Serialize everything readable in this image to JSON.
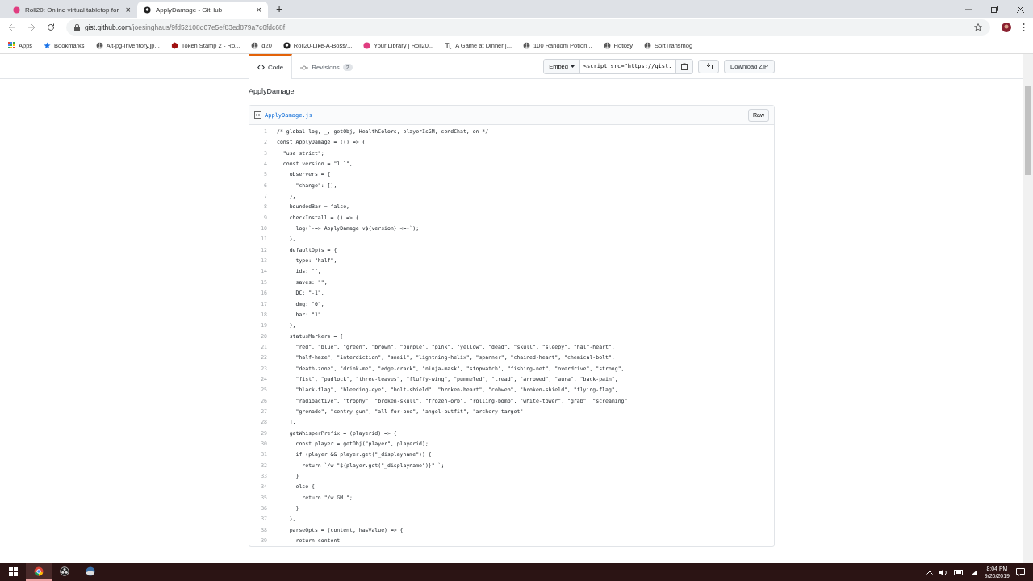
{
  "browser": {
    "tabs": [
      {
        "title": "Roll20: Online virtual tabletop for",
        "selected": false,
        "close": "×"
      },
      {
        "title": "ApplyDamage - GitHub",
        "selected": true,
        "close": "×"
      }
    ],
    "new_tab": "+",
    "address": {
      "host": "gist.github.com",
      "path": "/joesinghaus/9fd52108d07e5ef83ed879a7c6fdc68f"
    },
    "bookmarks": [
      {
        "label": "Apps",
        "kind": "apps"
      },
      {
        "label": "Bookmarks",
        "kind": "star"
      },
      {
        "label": "Alt-pg-inventory.jp...",
        "kind": "globe"
      },
      {
        "label": "Token Stamp 2 - Ro...",
        "kind": "hex"
      },
      {
        "label": "d20",
        "kind": "globe"
      },
      {
        "label": "Roll20-Like-A-Boss/...",
        "kind": "github"
      },
      {
        "label": "Your Library | Roll20...",
        "kind": "roll20"
      },
      {
        "label": "A Game at Dinner |...",
        "kind": "tl"
      },
      {
        "label": "100 Random Potion...",
        "kind": "globe"
      },
      {
        "label": "Hotkey",
        "kind": "globe"
      },
      {
        "label": "SortTransmog",
        "kind": "globe"
      }
    ]
  },
  "gist": {
    "tabs": [
      {
        "label": "Code",
        "selected": true
      },
      {
        "label": "Revisions",
        "count": "2",
        "selected": false
      }
    ],
    "embed": {
      "label": "Embed",
      "value": "<script src=\"https://gist."
    },
    "download": "Download ZIP",
    "title": "ApplyDamage",
    "file": {
      "name": "ApplyDamage.js",
      "raw": "Raw",
      "line_numbers": [
        "1",
        "2",
        "3",
        "4",
        "5",
        "6",
        "7",
        "8",
        "9",
        "10",
        "11",
        "12",
        "13",
        "14",
        "15",
        "16",
        "17",
        "18",
        "19",
        "20",
        "21",
        "22",
        "23",
        "24",
        "25",
        "26",
        "27",
        "28",
        "29",
        "30",
        "31",
        "32",
        "33",
        "34",
        "35",
        "36",
        "37",
        "38",
        "39"
      ],
      "lines": [
        "/* global log, _, getObj, HealthColors, playerIsGM, sendChat, on */",
        "const ApplyDamage = (() => {",
        "  \"use strict\";",
        "  const version = \"1.1\",",
        "    observers = {",
        "      \"change\": [],",
        "    },",
        "    boundedBar = false,",
        "    checkInstall = () => {",
        "      log(`-=> ApplyDamage v${version} <=-`);",
        "    },",
        "    defaultOpts = {",
        "      type: \"half\",",
        "      ids: \"\",",
        "      saves: \"\",",
        "      DC: \"-1\",",
        "      dmg: \"0\",",
        "      bar: \"1\"",
        "    },",
        "    statusMarkers = [",
        "      \"red\", \"blue\", \"green\", \"brown\", \"purple\", \"pink\", \"yellow\", \"dead\", \"skull\", \"sleepy\", \"half-heart\",",
        "      \"half-haze\", \"interdiction\", \"snail\", \"lightning-helix\", \"spanner\", \"chained-heart\", \"chemical-bolt\",",
        "      \"death-zone\", \"drink-me\", \"edge-crack\", \"ninja-mask\", \"stopwatch\", \"fishing-net\", \"overdrive\", \"strong\",",
        "      \"fist\", \"padlock\", \"three-leaves\", \"fluffy-wing\", \"pummeled\", \"tread\", \"arrowed\", \"aura\", \"back-pain\",",
        "      \"black-flag\", \"bleeding-eye\", \"bolt-shield\", \"broken-heart\", \"cobweb\", \"broken-shield\", \"flying-flag\",",
        "      \"radioactive\", \"trophy\", \"broken-skull\", \"frozen-orb\", \"rolling-bomb\", \"white-tower\", \"grab\", \"screaming\",",
        "      \"grenade\", \"sentry-gun\", \"all-for-one\", \"angel-outfit\", \"archery-target\"",
        "    ],",
        "    getWhisperPrefix = (playerid) => {",
        "      const player = getObj(\"player\", playerid);",
        "      if (player && player.get(\"_displayname\")) {",
        "        return `/w \"${player.get(\"_displayname\")}\" `;",
        "      }",
        "      else {",
        "        return \"/w GM \";",
        "      }",
        "    },",
        "    parseOpts = (content, hasValue) => {",
        "      return content"
      ]
    }
  },
  "taskbar": {
    "apps": [
      {
        "kind": "chrome",
        "selected": true
      },
      {
        "kind": "obs",
        "selected": false
      },
      {
        "kind": "globe",
        "selected": false
      }
    ],
    "time": "8:04 PM",
    "date": "9/20/2019"
  }
}
